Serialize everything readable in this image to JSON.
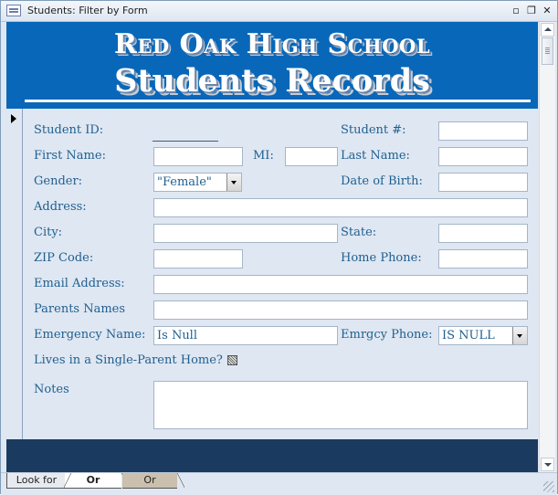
{
  "window": {
    "title": "Students: Filter by Form"
  },
  "header": {
    "school": "Red Oak High School",
    "subtitle": "Students Records"
  },
  "form": {
    "student_id_label": "Student ID:",
    "student_num_label": "Student #:",
    "first_name_label": "First Name:",
    "mi_label": "MI:",
    "last_name_label": "Last Name:",
    "gender_label": "Gender:",
    "gender_value": "\"Female\"",
    "dob_label": "Date of Birth:",
    "address_label": "Address:",
    "city_label": "City:",
    "state_label": "State:",
    "zip_label": "ZIP Code:",
    "home_phone_label": "Home Phone:",
    "email_label": "Email Address:",
    "parents_label": "Parents Names",
    "emergency_name_label": "Emergency Name:",
    "emergency_name_value": "Is Null",
    "emergency_phone_label": "Emrgcy Phone:",
    "emergency_phone_value": "IS NULL",
    "single_parent_label": "Lives in a Single-Parent Home?",
    "notes_label": "Notes"
  },
  "tabs": [
    {
      "label": "Look for"
    },
    {
      "label": "Or"
    },
    {
      "label": "Or"
    }
  ],
  "icons": {
    "minimize": "minimize-icon",
    "restore": "restore-icon",
    "close": "close-icon"
  }
}
